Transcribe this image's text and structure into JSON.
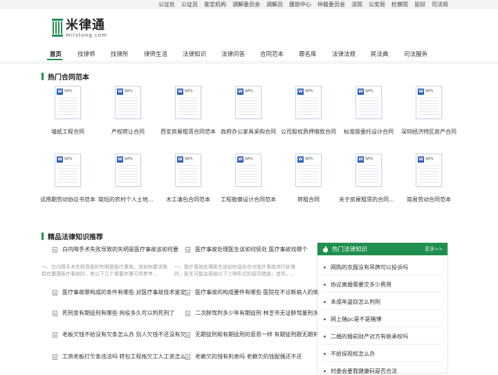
{
  "topbar": {
    "links": [
      "公证处",
      "公证员",
      "鉴定机构",
      "调解委员会",
      "调解员",
      "援助中心",
      "仲裁委员会",
      "法院",
      "公安局",
      "检察院",
      "监狱",
      "司法局"
    ]
  },
  "logo": {
    "name": "米律通",
    "domain": "milvtong.com"
  },
  "nav": {
    "items": [
      "首页",
      "找律师",
      "找律所",
      "律师生活",
      "法律知识",
      "法律问答",
      "合同范本",
      "罪名库",
      "法律法规",
      "民法典",
      "司法服务"
    ]
  },
  "contracts": {
    "title": "热门合同范本",
    "items": [
      "墙纸工程合同",
      "产权转让合同",
      "西安房屋租赁合同范本",
      "政府办公家具采购合同",
      "公司股权质押借款合同",
      "标准版委托设计合同",
      "深圳经济特区房产合同",
      "试用期劳动协议书范本",
      "简短的农村个人土地转让",
      "木工清包合同范本",
      "工程勘察设计合同范本",
      "转租合同",
      "关于房屋租赁的合同范本",
      "简易劳动合同范本"
    ],
    "doc_label": "WPS."
  },
  "knowledge": {
    "title": "精品法律知识推荐",
    "featured": [
      {
        "title": "白内障手术失败导致的失明是医疗事故该如何要",
        "summary": "一、白内障手术失败导致的失明是医疗事故，该如何要求赔偿在遭遇医疗事故时，有以下几个重要步骤可供参考..."
      },
      {
        "title": "医疗事故处理医生该如何惩处 医疗事故找哪个",
        "summary": "一、医疗事故处理医生该如何惩处在对医疗事故进行处理时，医生可能会面临以下三种形式的惩罚措施：首先，..."
      }
    ],
    "left": [
      "医疗事故罪构成的条件有哪些 对医疗事故技术鉴定",
      "死刑变有期徒刑有哪些 拘役多久可以判死刑了",
      "老板欠钱不给没有欠条怎么办 别人欠钱不还没有欠",
      "工资老板打欠条违法吗 转包工程拖欠工人工资怎么"
    ],
    "right": [
      "医疗事故的构成要件有哪些 医院在不诊断病人的情",
      "二次醉驾判多少年有期徒刑 林芝市无证醉驾量刑多",
      "无期徒刑和有期徒刑的意思一样 有期徒刑跟无期有",
      "老赖欠的钱有利息吗 老赖欠的钱配偶还不还"
    ]
  },
  "hot": {
    "title": "热门法律知识",
    "more": "更多>>",
    "items": [
      "网购的衣服没有吊牌可以投诉吗",
      "协议离婚需要交多少费用",
      "未成年盗窃怎么判刑",
      "网上赌pc是不是赌博",
      "二婚的婚前财产对方有继承权吗",
      "不给探视权怎么办",
      "村委会要我健康码是否合法"
    ]
  },
  "colors": {
    "accent": "#1e8f4f",
    "doc_icon": "#2b5eb8"
  }
}
